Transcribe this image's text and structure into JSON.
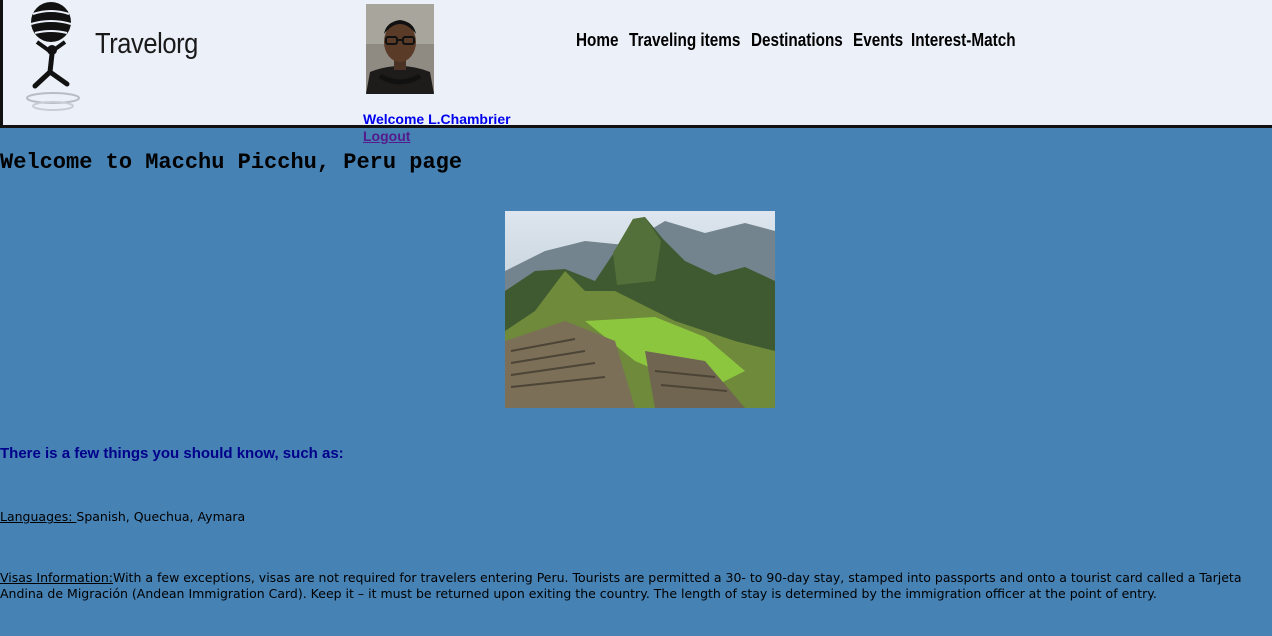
{
  "header": {
    "logo_text": "Travelorg",
    "nav": [
      {
        "label": "Home"
      },
      {
        "label": "Traveling items"
      },
      {
        "label": "Destinations"
      },
      {
        "label": "Events"
      },
      {
        "label": "Interest-Match"
      }
    ],
    "welcome": "Welcome L.Chambrier",
    "logout": "Logout"
  },
  "main": {
    "title": "Welcome to Macchu Picchu, Peru page",
    "subheading": "There is a few things you should know, such as:",
    "languages": {
      "label": "Languages: ",
      "text": "Spanish, Quechua, Aymara"
    },
    "visas": {
      "label": "Visas Information:",
      "text": "With a few exceptions, visas are not required for travelers entering Peru. Tourists are permitted a 30- to 90-day stay, stamped into passports and onto a tourist card called a Tarjeta Andina de Migración (Andean Immigration Card). Keep it – it must be returned upon exiting the country. The length of stay is determined by the immigration officer at the point of entry."
    }
  },
  "colors": {
    "page_background": "#4682b4",
    "header_background": "#ebf0f9",
    "welcome_link": "#0000ee",
    "logout_link": "#551a8b",
    "subheading": "#00008b"
  },
  "icons": {
    "logo": "atlas-globe-icon",
    "avatar": "user-photo",
    "hero": "machu-picchu-photo"
  }
}
